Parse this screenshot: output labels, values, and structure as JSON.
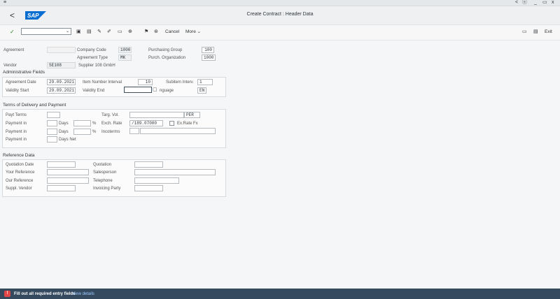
{
  "window": {
    "menu_glyph": "≡",
    "title": "Create Contract : Header Data",
    "controls": [
      "<",
      "ⓔ",
      "_",
      "▭",
      "x"
    ]
  },
  "shell": {
    "back": "<",
    "logo": "SAP"
  },
  "toolbar": {
    "cancel": "Cancel",
    "more": "More",
    "exit": "Exit"
  },
  "header": {
    "agreement_label": "Agreement",
    "agreement_value": "",
    "company_code_label": "Company Code",
    "company_code_value": "1000",
    "agreement_type_label": "Agreement Type",
    "agreement_type_value": "MK",
    "purchasing_group_label": "Purchasing Group",
    "purchasing_group_value": "100",
    "purch_org_label": "Purch. Organization",
    "purch_org_value": "1000",
    "vendor_label": "Vendor",
    "vendor_value": "SE108",
    "vendor_name": "Supplier 108 GmbH"
  },
  "admin": {
    "title": "Administrative Fields",
    "agreement_date_label": "Agreement Date",
    "agreement_date_value": "29.09.2021",
    "item_interval_label": "Item Number Interval",
    "item_interval_value": "10",
    "subitem_label": "Subitem Interv.",
    "subitem_value": "1",
    "validity_start_label": "Validity Start",
    "validity_start_value": "29.09.2021",
    "validity_end_label": "Validity End",
    "validity_end_value": "",
    "language_label": "nguage",
    "language_value": "EN"
  },
  "terms": {
    "title": "Terms of Delivery and Payment",
    "payt_terms_label": "Payt Terms",
    "targ_vol_label": "Targ. Vol.",
    "targ_vol_currency": "PER",
    "payment_in_label": "Payment in",
    "days_label": "Days",
    "percent": "%",
    "exch_rate_label": "Exch. Rate",
    "exch_rate_value": "/189.07000",
    "ex_rate_fx_label": "Ex.Rate Fx",
    "incoterms_label": "Incoterms",
    "days_net_label": "Days Net"
  },
  "reference": {
    "title": "Reference Data",
    "quotation_date_label": "Quotation Date",
    "quotation_label": "Quotation",
    "your_reference_label": "Your Reference",
    "salesperson_label": "Salesperson",
    "our_reference_label": "Our Reference",
    "telephone_label": "Telephone",
    "suppl_vendor_label": "Suppl. Vendor",
    "invoicing_party_label": "Invoicing Party"
  },
  "status": {
    "icon": "!",
    "message": "Fill out all required entry fields",
    "link": "View details"
  },
  "colors": {
    "shell_bg": "#eef0f2",
    "status_bar": "#354a5f",
    "error": "#e34646",
    "sap_blue": "#0a6ed1"
  }
}
